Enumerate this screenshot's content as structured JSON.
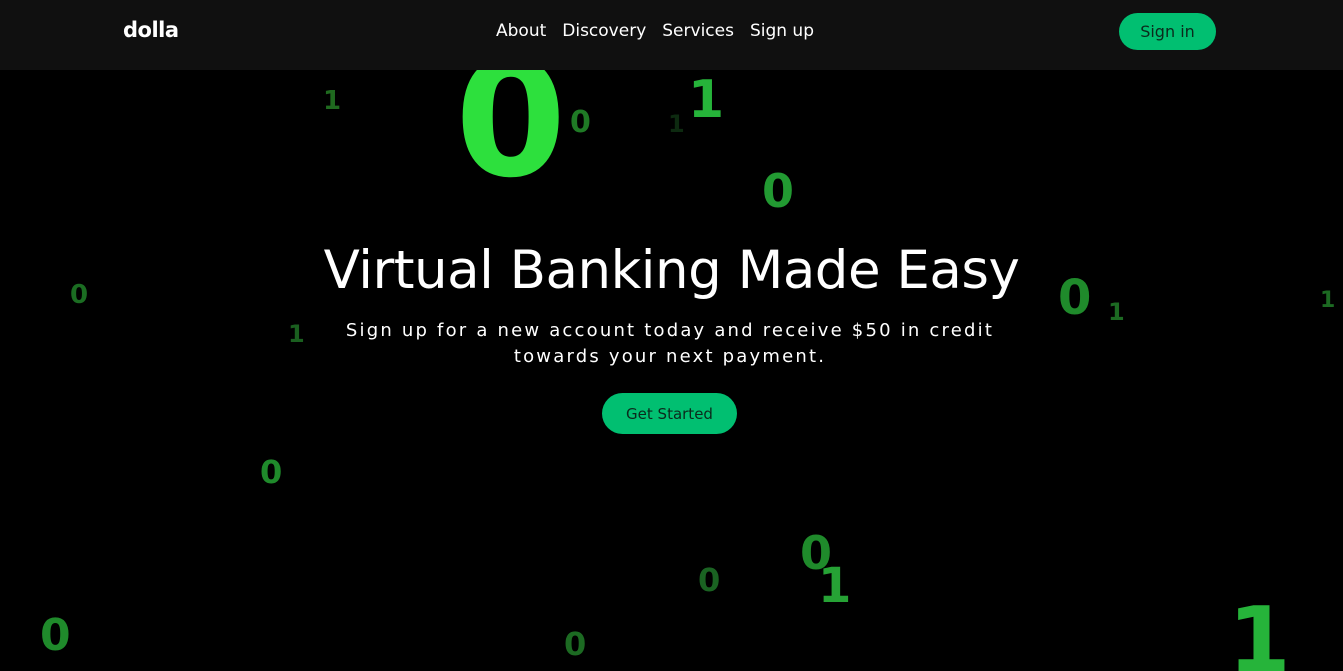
{
  "brand": {
    "logo_text": "dolla",
    "accent_color": "#01bf71"
  },
  "nav": {
    "links": [
      "About",
      "Discovery",
      "Services",
      "Sign up"
    ],
    "sign_in_label": "Sign in"
  },
  "hero": {
    "title": "Virtual Banking Made Easy",
    "subtitle_line1": "Sign up for a new account today and receive $50 in credit",
    "subtitle_line2": "towards your next payment.",
    "cta_label": "Get Started"
  },
  "background_digits": {
    "d0": "0",
    "d1": "1",
    "d2": "0",
    "d3": "1",
    "d4": "1",
    "d5": "0",
    "d6": "0",
    "d7": "0",
    "d8": "1",
    "d9": "1",
    "d10": "1",
    "d11": "0",
    "d12": "0",
    "d13": "1",
    "d14": "0",
    "d15": "0",
    "d16": "0",
    "d17": "1"
  }
}
